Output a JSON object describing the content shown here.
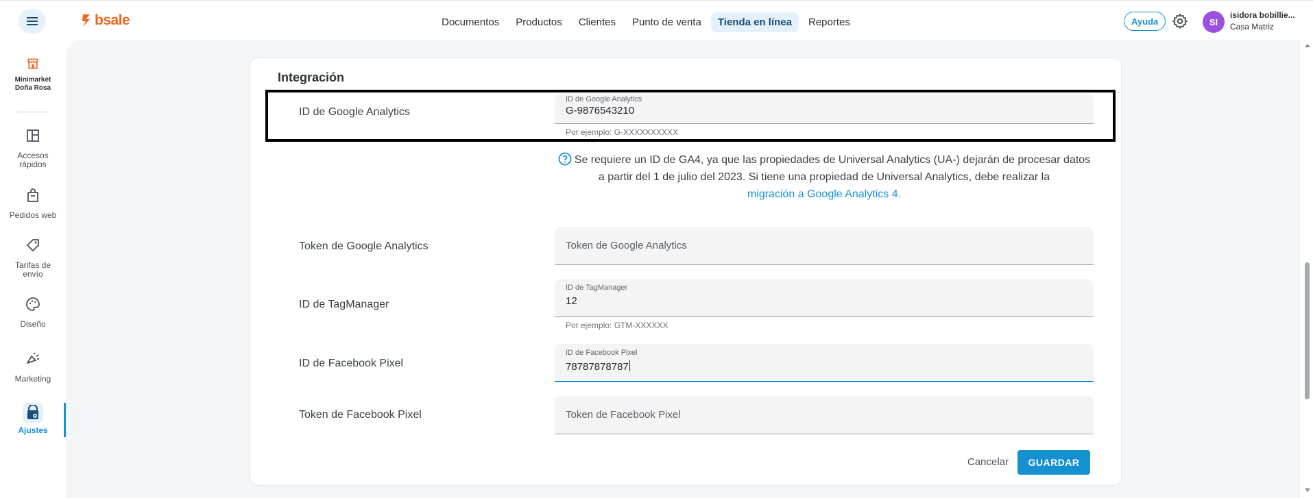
{
  "app": {
    "logo_text": "bsale",
    "brand_color": "#f2641f",
    "accent_color": "#1591d1"
  },
  "nav": {
    "items": [
      {
        "label": "Documentos"
      },
      {
        "label": "Productos"
      },
      {
        "label": "Clientes"
      },
      {
        "label": "Punto de venta"
      },
      {
        "label": "Tienda en línea",
        "active": true
      },
      {
        "label": "Reportes"
      }
    ]
  },
  "header": {
    "help_label": "Ayuda",
    "avatar_initials": "SI",
    "user_name": "isidora bobillie...",
    "user_branch": "Casa Matriz"
  },
  "sidebar": {
    "store_name_line1": "Minimarket",
    "store_name_line2": "Doña Rosa",
    "items": [
      {
        "label_line1": "Accesos",
        "label_line2": "rápidos",
        "icon": "layout-icon"
      },
      {
        "label_line1": "Pedidos web",
        "label_line2": "",
        "icon": "shopping-bag-icon"
      },
      {
        "label_line1": "Tarifas de",
        "label_line2": "envío",
        "icon": "tag-icon"
      },
      {
        "label_line1": "Diseño",
        "label_line2": "",
        "icon": "palette-icon"
      },
      {
        "label_line1": "Marketing",
        "label_line2": "",
        "icon": "megaphone-icon"
      },
      {
        "label_line1": "Ajustes",
        "label_line2": "",
        "icon": "store-settings-icon",
        "active": true
      }
    ]
  },
  "form": {
    "section_title": "Integración",
    "ga_id": {
      "label": "ID de Google Analytics",
      "floating_label": "ID de Google Analytics",
      "value": "G-9876543210",
      "helper": "Por ejemplo: G-XXXXXXXXXX"
    },
    "info": {
      "text": "Se requiere un ID de GA4, ya que las propiedades de Universal Analytics (UA-) dejarán de procesar datos a partir del 1 de julio del 2023. Si tiene una propiedad de Universal Analytics, debe realizar la",
      "link": "migración a Google Analytics 4."
    },
    "ga_token": {
      "label": "Token de Google Analytics",
      "placeholder": "Token de Google Analytics"
    },
    "tagmanager": {
      "label": "ID de TagManager",
      "floating_label": "ID de TagManager",
      "value": "12",
      "helper": "Por ejemplo: GTM-XXXXXX"
    },
    "fb_pixel": {
      "label": "ID de Facebook Pixel",
      "floating_label": "ID de Facebook Pixel",
      "value": "78787878787"
    },
    "fb_token": {
      "label": "Token de Facebook Pixel",
      "placeholder": "Token de Facebook Pixel"
    },
    "cancel_label": "Cancelar",
    "save_label": "GUARDAR"
  }
}
